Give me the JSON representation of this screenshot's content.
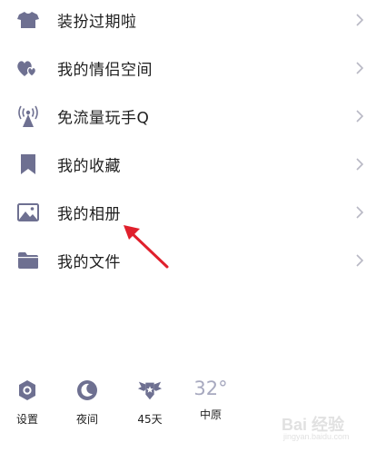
{
  "menu": {
    "items": [
      {
        "label": "装扮过期啦",
        "icon": "tshirt-icon"
      },
      {
        "label": "我的情侣空间",
        "icon": "hearts-icon"
      },
      {
        "label": "免流量玩手Q",
        "icon": "signal-tower-icon"
      },
      {
        "label": "我的收藏",
        "icon": "bookmark-icon"
      },
      {
        "label": "我的相册",
        "icon": "photo-icon"
      },
      {
        "label": "我的文件",
        "icon": "folder-icon"
      }
    ]
  },
  "bottom_bar": {
    "settings_label": "设置",
    "night_label": "夜间",
    "days_label": "45天",
    "weather_temp": "32°",
    "weather_city": "中原"
  },
  "watermark": {
    "brand": "Bai 经验",
    "url": "jingyan.baidu.com"
  },
  "colors": {
    "icon": "#6e7091",
    "chevron": "#b8b8c4",
    "arrow": "#e0202c",
    "temp": "#a7a9bf"
  }
}
